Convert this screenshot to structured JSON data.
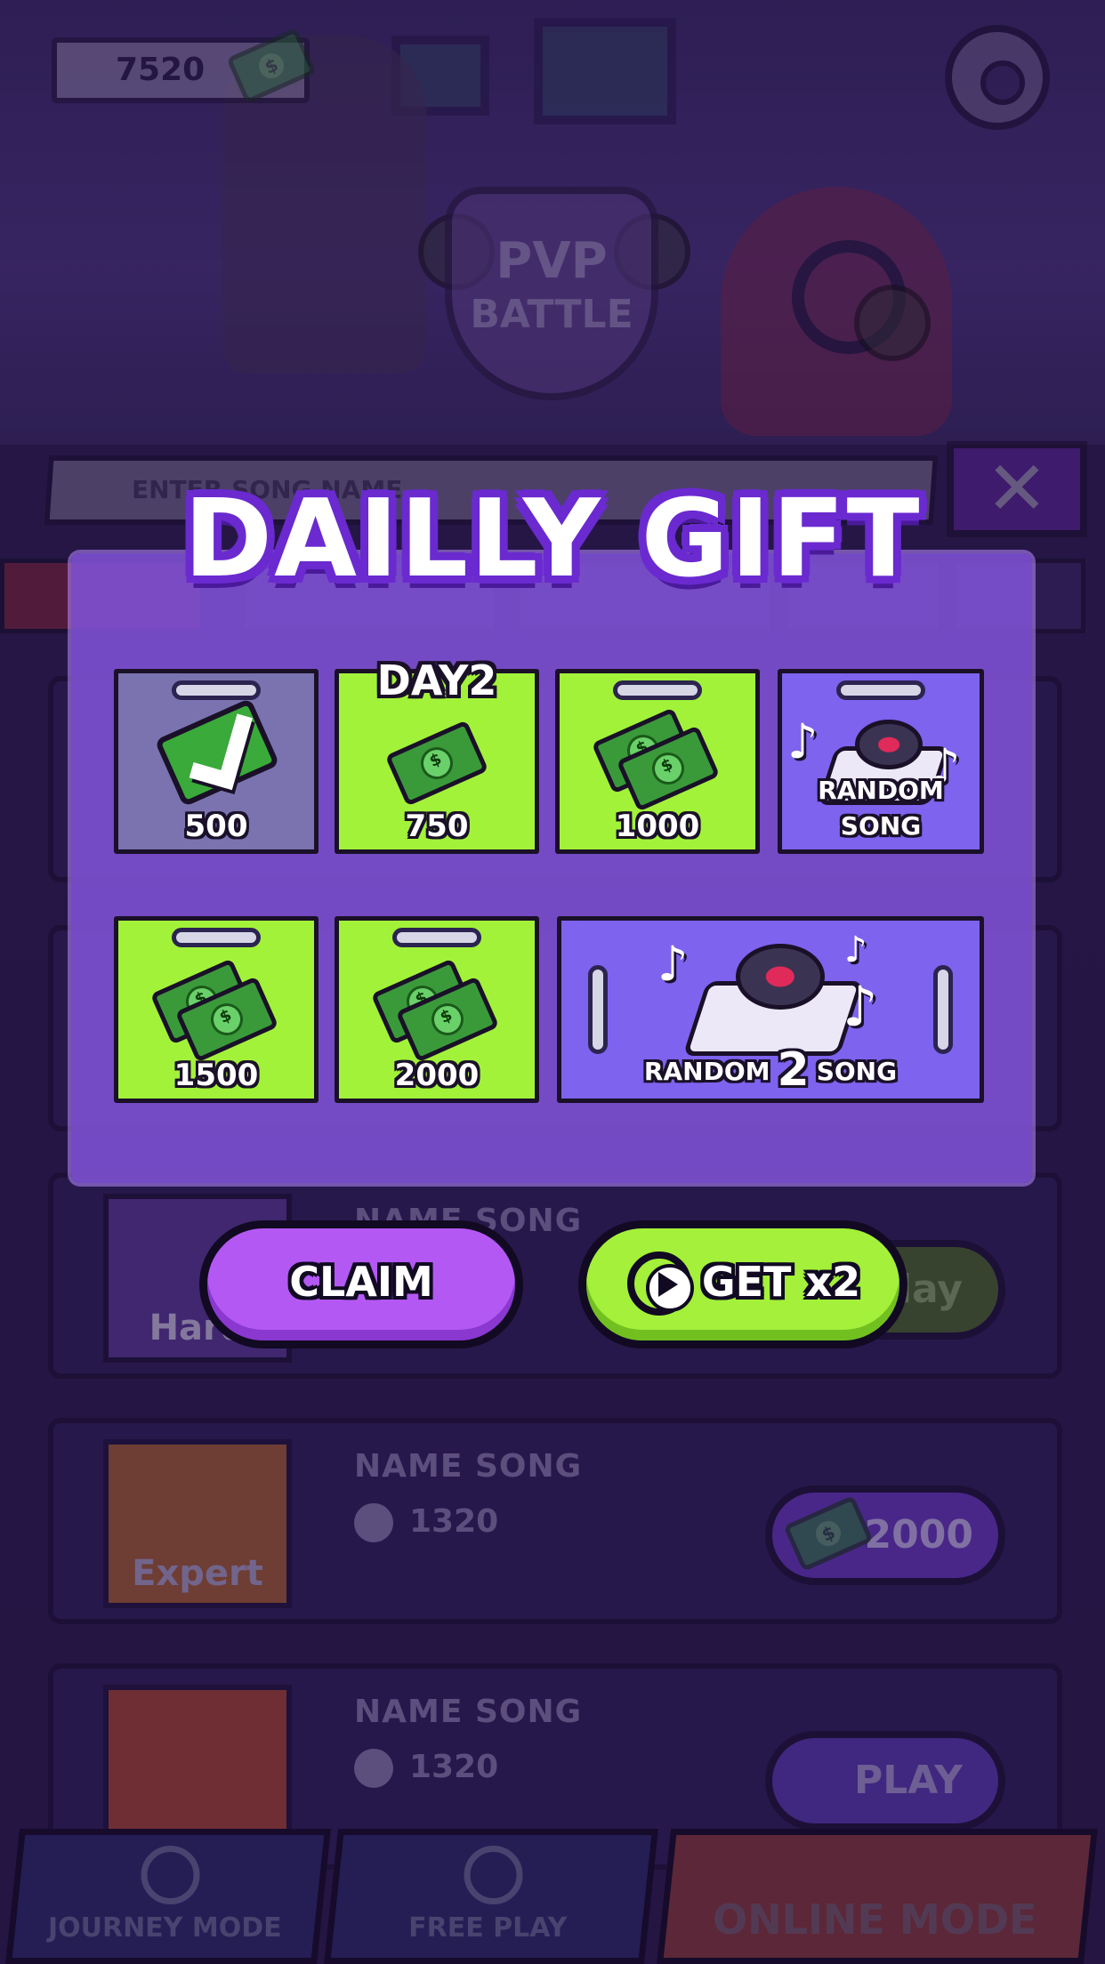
{
  "hud": {
    "coins": "7520",
    "settings_icon": "gear-icon",
    "logo_line1": "PVP",
    "logo_line2": "BATTLE"
  },
  "search": {
    "placeholder": "ENTER SONG NAME",
    "close_icon": "close-icon"
  },
  "songs": [
    {
      "name": "NAME SONG",
      "difficulty": "Hard",
      "plays": "",
      "action": "Play"
    },
    {
      "name": "NAME SONG",
      "difficulty": "Expert",
      "plays": "1320",
      "price": "2000"
    },
    {
      "name": "NAME SONG",
      "difficulty": "",
      "plays": "1320",
      "action": "PLAY"
    }
  ],
  "bottom_nav": {
    "journey": "JOURNEY MODE",
    "free_play": "FREE PLAY",
    "online": "ONLINE MODE"
  },
  "daily_gift": {
    "title": "DAILLY GIFT",
    "rewards": [
      {
        "label": "500",
        "state": "claimed",
        "icon": "check-cash-icon"
      },
      {
        "label": "750",
        "state": "current",
        "day_tag": "DAY2",
        "icon": "cash-icon"
      },
      {
        "label": "1000",
        "state": "locked",
        "icon": "cash-stack-icon"
      },
      {
        "label": "RANDOM SONG",
        "state": "locked",
        "icon": "turntable-icon"
      },
      {
        "label": "1500",
        "state": "locked",
        "icon": "cash-stack-icon"
      },
      {
        "label": "2000",
        "state": "locked",
        "icon": "cash-stack-icon"
      },
      {
        "label_pre": "RANDOM",
        "label_num": "2",
        "label_post": "SONG",
        "state": "locked",
        "icon": "turntable-icon"
      }
    ],
    "claim_label": "CLAIM",
    "double_label": "GET x2"
  },
  "colors": {
    "panel": "#8052d6",
    "tile_green": "#a2f23a",
    "tile_claimed": "#7a73b0",
    "tile_song": "#7d63ee",
    "claim_button": "#b458f4",
    "double_button": "#a4f03a"
  }
}
